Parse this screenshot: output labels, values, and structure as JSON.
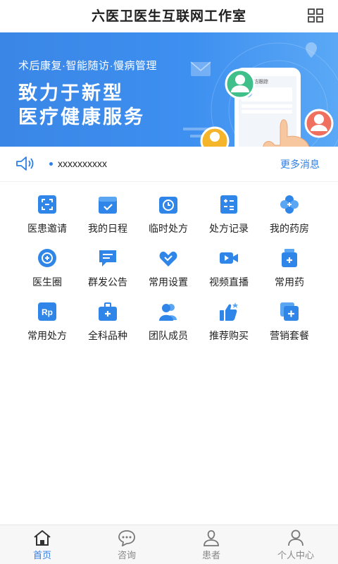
{
  "header": {
    "title": "六医卫医生互联网工作室"
  },
  "banner": {
    "subtitle": "术后康复·智能随访·慢病管理",
    "slogan_line1": "致力于新型",
    "slogan_line2": "医疗健康服务",
    "phone_screen_title": "随访跟踪"
  },
  "notice": {
    "text": "xxxxxxxxxx",
    "more_label": "更多消息"
  },
  "grid": {
    "items": [
      {
        "label": "医患邀请",
        "icon": "scan-icon"
      },
      {
        "label": "我的日程",
        "icon": "calendar-icon"
      },
      {
        "label": "临时处方",
        "icon": "clock-icon"
      },
      {
        "label": "处方记录",
        "icon": "record-icon"
      },
      {
        "label": "我的药房",
        "icon": "clover-icon"
      },
      {
        "label": "医生圈",
        "icon": "circle-icon"
      },
      {
        "label": "群发公告",
        "icon": "chat-icon"
      },
      {
        "label": "常用设置",
        "icon": "handshake-icon"
      },
      {
        "label": "视频直播",
        "icon": "video-icon"
      },
      {
        "label": "常用药",
        "icon": "medicine-icon"
      },
      {
        "label": "常用处方",
        "icon": "rp-icon"
      },
      {
        "label": "全科品种",
        "icon": "medkit-icon"
      },
      {
        "label": "团队成员",
        "icon": "team-icon"
      },
      {
        "label": "推荐购买",
        "icon": "thumbs-up-icon"
      },
      {
        "label": "营销套餐",
        "icon": "package-icon"
      }
    ]
  },
  "tabbar": {
    "tabs": [
      {
        "label": "首页",
        "icon": "home-icon",
        "active": true
      },
      {
        "label": "咨询",
        "icon": "chat-bubble-icon",
        "active": false
      },
      {
        "label": "患者",
        "icon": "patient-icon",
        "active": false
      },
      {
        "label": "个人中心",
        "icon": "user-icon",
        "active": false
      }
    ]
  },
  "colors": {
    "accent": "#2f7ee6",
    "banner": "#3d8ff0",
    "icon_blue": "#2f86e8",
    "inactive": "#888888"
  }
}
